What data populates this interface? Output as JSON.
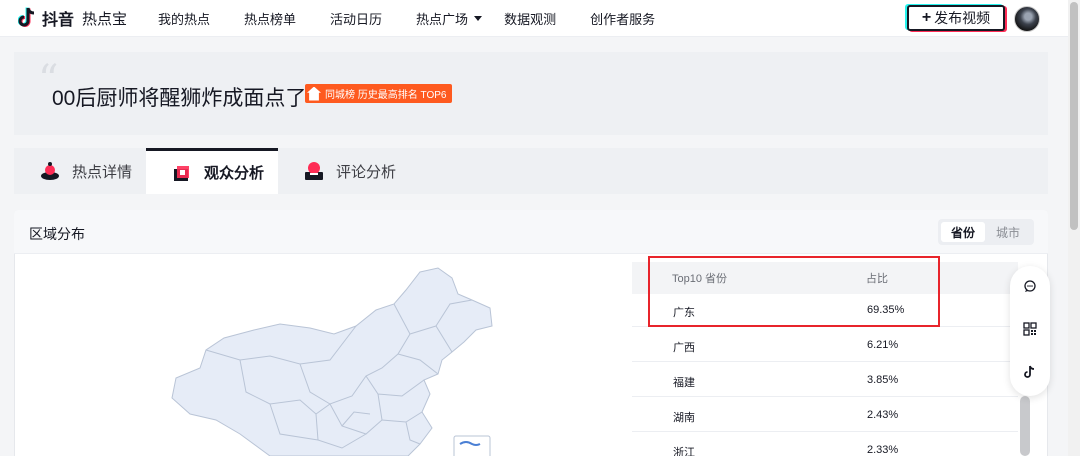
{
  "app": {
    "brand": "抖音",
    "product": "热点宝"
  },
  "nav": {
    "items": [
      "我的热点",
      "热点榜单",
      "活动日历",
      "热点广场",
      "数据观测",
      "创作者服务"
    ],
    "publish_label": "发布视频"
  },
  "topic": {
    "title": "00后厨师将醒狮炸成面点了",
    "badge": "同城榜 历史最高排名 TOP6"
  },
  "tabs": [
    {
      "label": "热点详情",
      "icon": "hotspot-detail-icon"
    },
    {
      "label": "观众分析",
      "icon": "audience-analysis-icon"
    },
    {
      "label": "评论分析",
      "icon": "comment-analysis-icon"
    }
  ],
  "region": {
    "title": "区域分布",
    "toggle": {
      "province": "省份",
      "city": "城市",
      "selected": "省份"
    },
    "table": {
      "headers": [
        "Top10 省份",
        "占比"
      ],
      "rows": [
        {
          "name": "广东",
          "pct": "69.35%"
        },
        {
          "name": "广西",
          "pct": "6.21%"
        },
        {
          "name": "福建",
          "pct": "3.85%"
        },
        {
          "name": "湖南",
          "pct": "2.43%"
        },
        {
          "name": "浙江",
          "pct": "2.33%"
        }
      ]
    }
  },
  "colors": {
    "accent_red": "#e8242b",
    "badge_orange": "#fe5a1f",
    "map_fill": "#e6ecf7",
    "map_stroke": "#b9c4d6"
  }
}
